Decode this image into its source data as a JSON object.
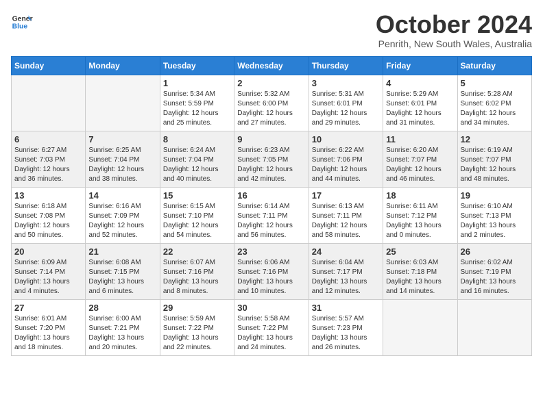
{
  "header": {
    "logo_line1": "General",
    "logo_line2": "Blue",
    "title": "October 2024",
    "location": "Penrith, New South Wales, Australia"
  },
  "days_of_week": [
    "Sunday",
    "Monday",
    "Tuesday",
    "Wednesday",
    "Thursday",
    "Friday",
    "Saturday"
  ],
  "weeks": [
    [
      {
        "day": "",
        "info": ""
      },
      {
        "day": "",
        "info": ""
      },
      {
        "day": "1",
        "info": "Sunrise: 5:34 AM\nSunset: 5:59 PM\nDaylight: 12 hours\nand 25 minutes."
      },
      {
        "day": "2",
        "info": "Sunrise: 5:32 AM\nSunset: 6:00 PM\nDaylight: 12 hours\nand 27 minutes."
      },
      {
        "day": "3",
        "info": "Sunrise: 5:31 AM\nSunset: 6:01 PM\nDaylight: 12 hours\nand 29 minutes."
      },
      {
        "day": "4",
        "info": "Sunrise: 5:29 AM\nSunset: 6:01 PM\nDaylight: 12 hours\nand 31 minutes."
      },
      {
        "day": "5",
        "info": "Sunrise: 5:28 AM\nSunset: 6:02 PM\nDaylight: 12 hours\nand 34 minutes."
      }
    ],
    [
      {
        "day": "6",
        "info": "Sunrise: 6:27 AM\nSunset: 7:03 PM\nDaylight: 12 hours\nand 36 minutes."
      },
      {
        "day": "7",
        "info": "Sunrise: 6:25 AM\nSunset: 7:04 PM\nDaylight: 12 hours\nand 38 minutes."
      },
      {
        "day": "8",
        "info": "Sunrise: 6:24 AM\nSunset: 7:04 PM\nDaylight: 12 hours\nand 40 minutes."
      },
      {
        "day": "9",
        "info": "Sunrise: 6:23 AM\nSunset: 7:05 PM\nDaylight: 12 hours\nand 42 minutes."
      },
      {
        "day": "10",
        "info": "Sunrise: 6:22 AM\nSunset: 7:06 PM\nDaylight: 12 hours\nand 44 minutes."
      },
      {
        "day": "11",
        "info": "Sunrise: 6:20 AM\nSunset: 7:07 PM\nDaylight: 12 hours\nand 46 minutes."
      },
      {
        "day": "12",
        "info": "Sunrise: 6:19 AM\nSunset: 7:07 PM\nDaylight: 12 hours\nand 48 minutes."
      }
    ],
    [
      {
        "day": "13",
        "info": "Sunrise: 6:18 AM\nSunset: 7:08 PM\nDaylight: 12 hours\nand 50 minutes."
      },
      {
        "day": "14",
        "info": "Sunrise: 6:16 AM\nSunset: 7:09 PM\nDaylight: 12 hours\nand 52 minutes."
      },
      {
        "day": "15",
        "info": "Sunrise: 6:15 AM\nSunset: 7:10 PM\nDaylight: 12 hours\nand 54 minutes."
      },
      {
        "day": "16",
        "info": "Sunrise: 6:14 AM\nSunset: 7:11 PM\nDaylight: 12 hours\nand 56 minutes."
      },
      {
        "day": "17",
        "info": "Sunrise: 6:13 AM\nSunset: 7:11 PM\nDaylight: 12 hours\nand 58 minutes."
      },
      {
        "day": "18",
        "info": "Sunrise: 6:11 AM\nSunset: 7:12 PM\nDaylight: 13 hours\nand 0 minutes."
      },
      {
        "day": "19",
        "info": "Sunrise: 6:10 AM\nSunset: 7:13 PM\nDaylight: 13 hours\nand 2 minutes."
      }
    ],
    [
      {
        "day": "20",
        "info": "Sunrise: 6:09 AM\nSunset: 7:14 PM\nDaylight: 13 hours\nand 4 minutes."
      },
      {
        "day": "21",
        "info": "Sunrise: 6:08 AM\nSunset: 7:15 PM\nDaylight: 13 hours\nand 6 minutes."
      },
      {
        "day": "22",
        "info": "Sunrise: 6:07 AM\nSunset: 7:16 PM\nDaylight: 13 hours\nand 8 minutes."
      },
      {
        "day": "23",
        "info": "Sunrise: 6:06 AM\nSunset: 7:16 PM\nDaylight: 13 hours\nand 10 minutes."
      },
      {
        "day": "24",
        "info": "Sunrise: 6:04 AM\nSunset: 7:17 PM\nDaylight: 13 hours\nand 12 minutes."
      },
      {
        "day": "25",
        "info": "Sunrise: 6:03 AM\nSunset: 7:18 PM\nDaylight: 13 hours\nand 14 minutes."
      },
      {
        "day": "26",
        "info": "Sunrise: 6:02 AM\nSunset: 7:19 PM\nDaylight: 13 hours\nand 16 minutes."
      }
    ],
    [
      {
        "day": "27",
        "info": "Sunrise: 6:01 AM\nSunset: 7:20 PM\nDaylight: 13 hours\nand 18 minutes."
      },
      {
        "day": "28",
        "info": "Sunrise: 6:00 AM\nSunset: 7:21 PM\nDaylight: 13 hours\nand 20 minutes."
      },
      {
        "day": "29",
        "info": "Sunrise: 5:59 AM\nSunset: 7:22 PM\nDaylight: 13 hours\nand 22 minutes."
      },
      {
        "day": "30",
        "info": "Sunrise: 5:58 AM\nSunset: 7:22 PM\nDaylight: 13 hours\nand 24 minutes."
      },
      {
        "day": "31",
        "info": "Sunrise: 5:57 AM\nSunset: 7:23 PM\nDaylight: 13 hours\nand 26 minutes."
      },
      {
        "day": "",
        "info": ""
      },
      {
        "day": "",
        "info": ""
      }
    ]
  ]
}
